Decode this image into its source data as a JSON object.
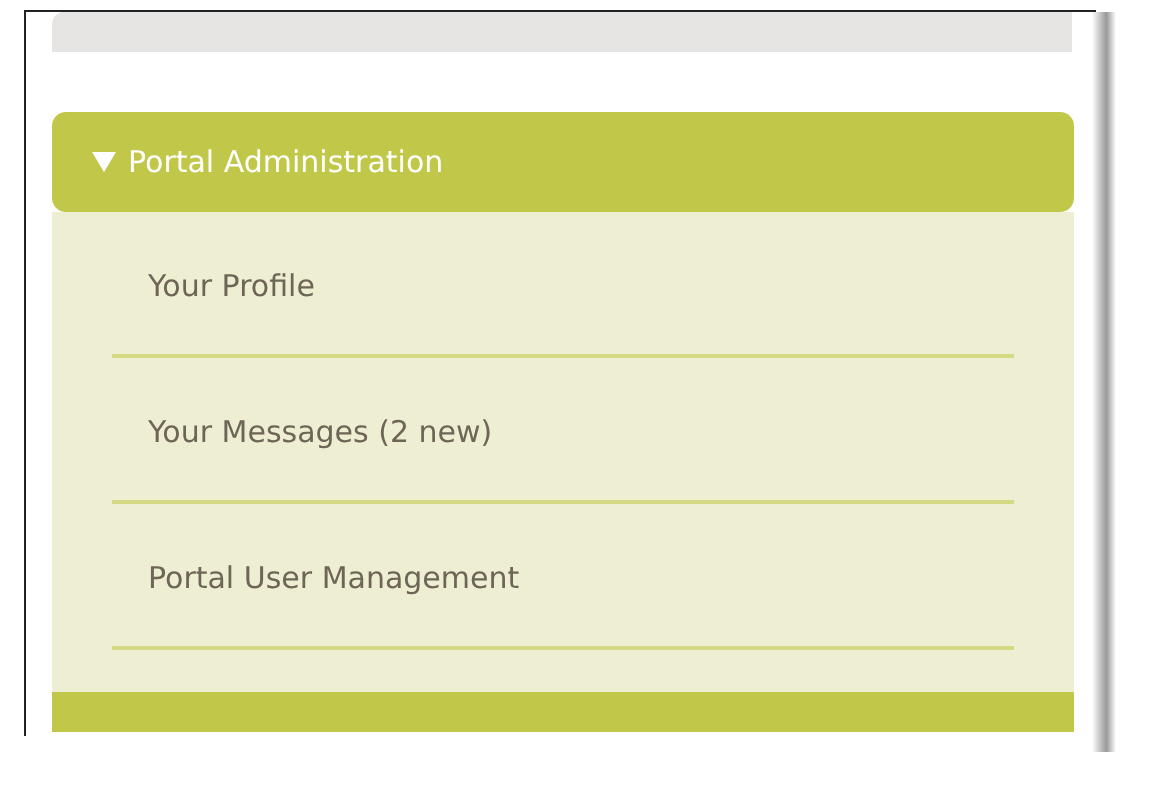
{
  "menu": {
    "title": "Portal Administration",
    "expanded": true,
    "items": [
      {
        "label": "Your Profile"
      },
      {
        "label": "Your Messages (2 new)"
      },
      {
        "label": "Portal User Management"
      }
    ]
  }
}
